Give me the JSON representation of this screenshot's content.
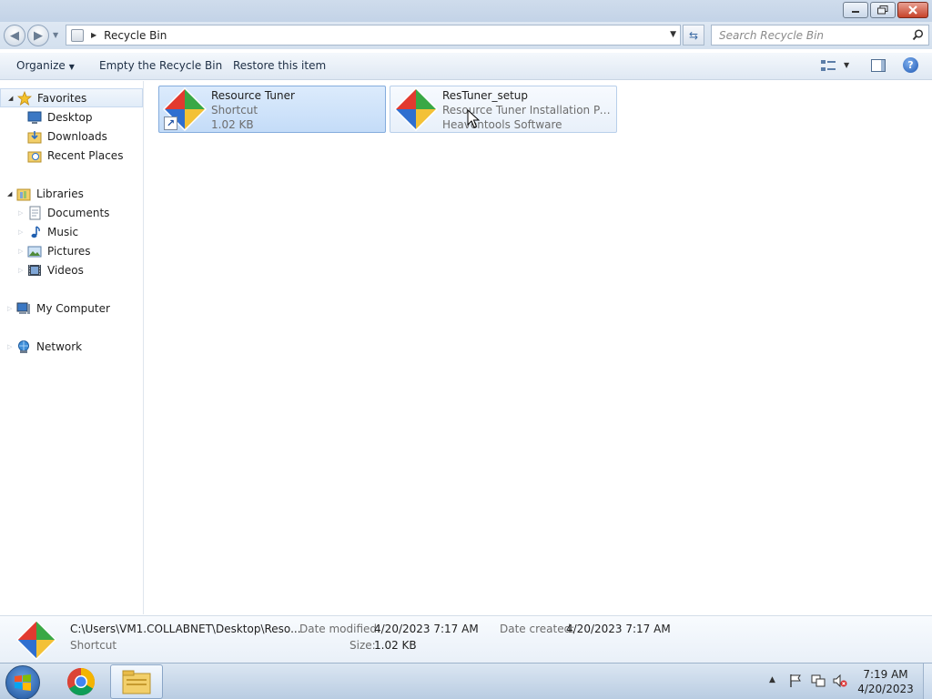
{
  "window": {
    "title": "",
    "controls": {
      "minimize": "minimize",
      "maximize": "maximize",
      "close": "close"
    }
  },
  "address": {
    "icon": "recycle-bin-icon",
    "path": "Recycle Bin",
    "search_placeholder": "Search Recycle Bin"
  },
  "toolbar": {
    "organize_label": "Organize",
    "empty_label": "Empty the Recycle Bin",
    "restore_label": "Restore this item"
  },
  "sidebar": {
    "favorites": {
      "label": "Favorites",
      "items": [
        {
          "label": "Desktop",
          "icon": "desktop-icon"
        },
        {
          "label": "Downloads",
          "icon": "downloads-icon"
        },
        {
          "label": "Recent Places",
          "icon": "recent-places-icon"
        }
      ]
    },
    "libraries": {
      "label": "Libraries",
      "items": [
        {
          "label": "Documents",
          "icon": "documents-icon"
        },
        {
          "label": "Music",
          "icon": "music-icon"
        },
        {
          "label": "Pictures",
          "icon": "pictures-icon"
        },
        {
          "label": "Videos",
          "icon": "videos-icon"
        }
      ]
    },
    "computer": {
      "label": "My Computer",
      "icon": "computer-icon"
    },
    "network": {
      "label": "Network",
      "icon": "network-icon"
    }
  },
  "files": [
    {
      "name": "Resource Tuner",
      "line2": "Shortcut",
      "line3": "1.02 KB",
      "selected": true,
      "shortcut": true
    },
    {
      "name": "ResTuner_setup",
      "line2": "Resource Tuner Installation Packa...",
      "line3": "Heaventools Software",
      "selected": false,
      "shortcut": false
    }
  ],
  "details": {
    "path": "C:\\Users\\VM1.COLLABNET\\Desktop\\Reso...",
    "type": "Shortcut",
    "date_modified_label": "Date modified:",
    "date_modified": "4/20/2023 7:17 AM",
    "date_created_label": "Date created:",
    "date_created": "4/20/2023 7:17 AM",
    "size_label": "Size:",
    "size": "1.02 KB"
  },
  "taskbar": {
    "time": "7:19 AM",
    "date": "4/20/2023",
    "pinned": [
      "start-orb",
      "chrome-icon",
      "explorer-icon"
    ]
  },
  "colors": {
    "selection": "#c4dcf8",
    "selection_border": "#84acdd",
    "chrome_gradient": "#d3e0ee"
  }
}
